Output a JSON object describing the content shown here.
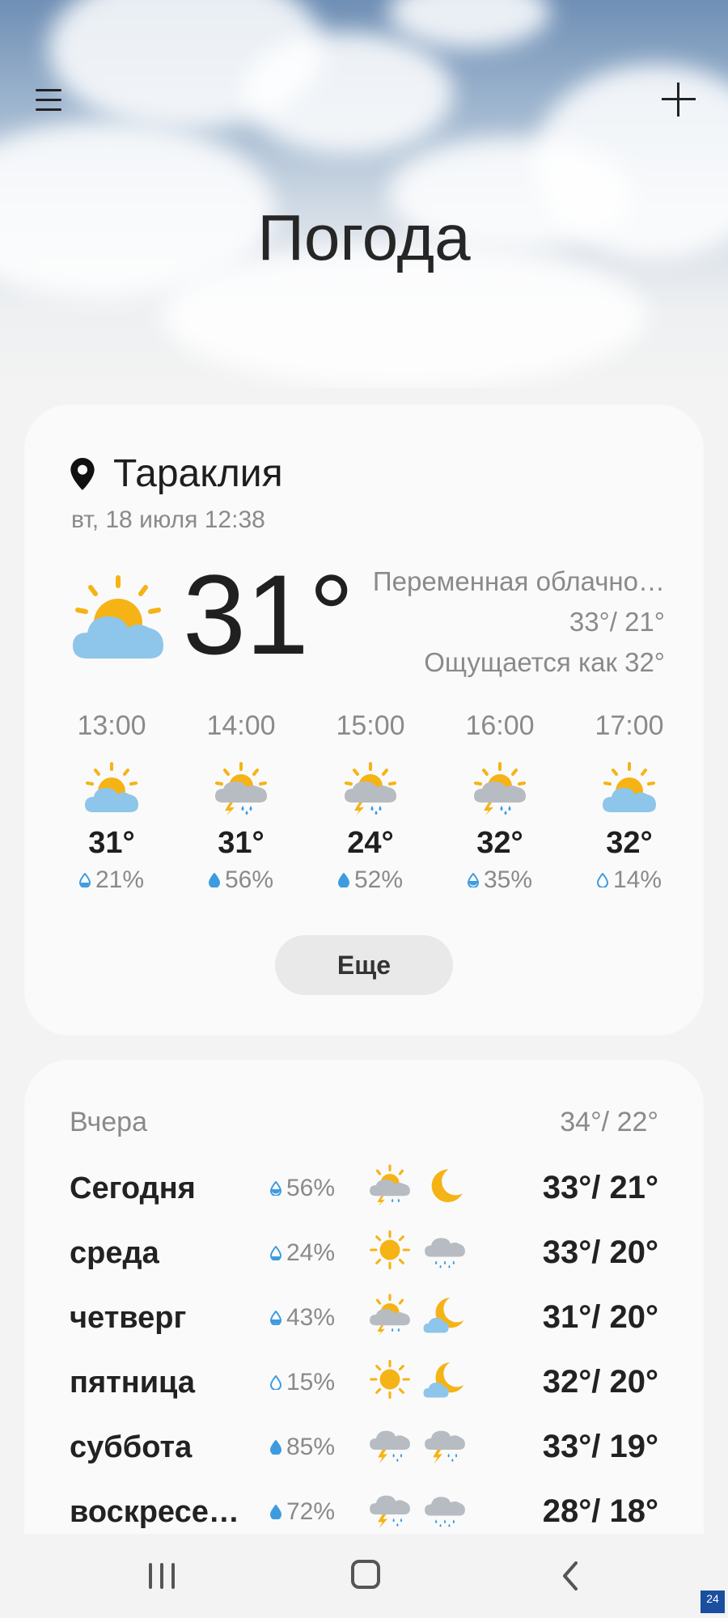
{
  "app": {
    "title": "Погода"
  },
  "icons": {
    "menu": "menu-icon",
    "add": "plus-icon",
    "location": "location-pin-icon"
  },
  "current": {
    "location": "Тараклия",
    "datetime": "вт, 18 июля 12:38",
    "temperature": "31°",
    "condition": "Переменная облачно…",
    "hilo": "33°/ 21°",
    "feels_like": "Ощущается как 32°",
    "icon": "partly-sunny-icon"
  },
  "hourly": [
    {
      "time": "13:00",
      "temp": "31°",
      "precip": "21%",
      "icon": "partly-sunny-icon"
    },
    {
      "time": "14:00",
      "temp": "31°",
      "precip": "56%",
      "icon": "thunder-rain-sun-icon"
    },
    {
      "time": "15:00",
      "temp": "24°",
      "precip": "52%",
      "icon": "thunder-rain-sun-icon"
    },
    {
      "time": "16:00",
      "temp": "32°",
      "precip": "35%",
      "icon": "thunder-rain-sun-icon"
    },
    {
      "time": "17:00",
      "temp": "32°",
      "precip": "14%",
      "icon": "partly-sunny-icon"
    }
  ],
  "more_label": "Еще",
  "daily": {
    "yesterday_label": "Вчера",
    "yesterday_temp": "34°/ 22°",
    "days": [
      {
        "name": "Сегодня",
        "precip": "56%",
        "day_icon": "thunder-rain-sun-icon",
        "night_icon": "moon-icon",
        "temp": "33°/ 21°"
      },
      {
        "name": "среда",
        "precip": "24%",
        "day_icon": "sun-icon",
        "night_icon": "rain-cloud-icon",
        "temp": "33°/ 20°"
      },
      {
        "name": "четверг",
        "precip": "43%",
        "day_icon": "thunder-rain-sun-icon",
        "night_icon": "moon-cloud-icon",
        "temp": "31°/ 20°"
      },
      {
        "name": "пятница",
        "precip": "15%",
        "day_icon": "sun-icon",
        "night_icon": "moon-cloud-icon",
        "temp": "32°/ 20°"
      },
      {
        "name": "суббота",
        "precip": "85%",
        "day_icon": "thunder-rain-icon",
        "night_icon": "thunder-rain-icon",
        "temp": "33°/ 19°"
      },
      {
        "name": "воскресе…",
        "precip": "72%",
        "day_icon": "thunder-rain-icon",
        "night_icon": "rain-cloud-icon",
        "temp": "28°/ 18°"
      }
    ]
  },
  "navbar": {
    "recent": "recent-apps-icon",
    "home": "home-icon",
    "back": "back-icon"
  },
  "watermark": "24",
  "colors": {
    "sun": "#f5b316",
    "cloud_blue": "#8ec5ea",
    "cloud_grey": "#b7bcc2",
    "rain": "#3d9be0",
    "background": "#f3f3f3",
    "card": "#fafafa"
  }
}
